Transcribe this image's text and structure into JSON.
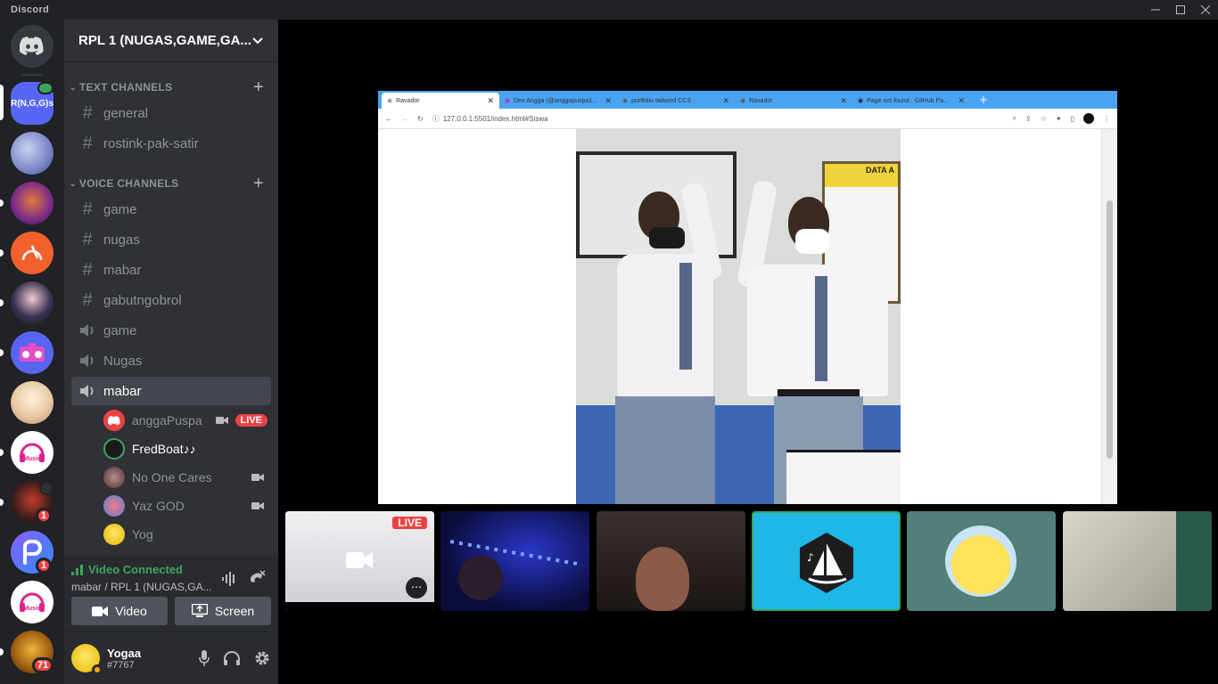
{
  "app": {
    "title": "Discord"
  },
  "rail": {
    "first_server_label": "R(N,G,G)s",
    "badges": {
      "server9": "1",
      "server10": "1",
      "server12": "71"
    }
  },
  "guild": {
    "name": "RPL 1 (NUGAS,GAME,GA..."
  },
  "categories": {
    "text": "TEXT CHANNELS",
    "voice": "VOICE CHANNELS"
  },
  "text_channels": [
    "general",
    "rostink-pak-satir"
  ],
  "voice_channels": [
    {
      "name": "game",
      "kind": "text"
    },
    {
      "name": "nugas",
      "kind": "text"
    },
    {
      "name": "mabar",
      "kind": "text"
    },
    {
      "name": "gabutngobrol",
      "kind": "text"
    },
    {
      "name": "game",
      "kind": "voice"
    },
    {
      "name": "Nugas",
      "kind": "voice"
    },
    {
      "name": "mabar",
      "kind": "voice"
    }
  ],
  "voice_users": [
    {
      "name": "anggaPuspa",
      "live": "LIVE"
    },
    {
      "name": "FredBoat♪♪"
    },
    {
      "name": "No One Cares"
    },
    {
      "name": "Yaz GOD"
    },
    {
      "name": "Yog"
    }
  ],
  "voice_status": {
    "title": "Video Connected",
    "subtitle": "mabar / RPL 1 (NUGAS,GA..."
  },
  "buttons": {
    "video": "Video",
    "screen": "Screen"
  },
  "user": {
    "name": "Yogaa",
    "tag": "#7767"
  },
  "stream": {
    "tabs": [
      "Ravador",
      "Dex Angga (@anggapuspa1...",
      "portfolio tailwind CCS",
      "Ravador",
      "Page not found · GitHub Pa..."
    ],
    "url": "127.0.0.1:5501/index.html#Siswa",
    "board_text": "DATA A"
  },
  "thumbs": {
    "live_label": "LIVE"
  },
  "colors": {
    "accent": "#5865f2",
    "live": "#ed4245",
    "green": "#3ba55d",
    "rail": "#202225",
    "sidebar": "#2f3136"
  }
}
